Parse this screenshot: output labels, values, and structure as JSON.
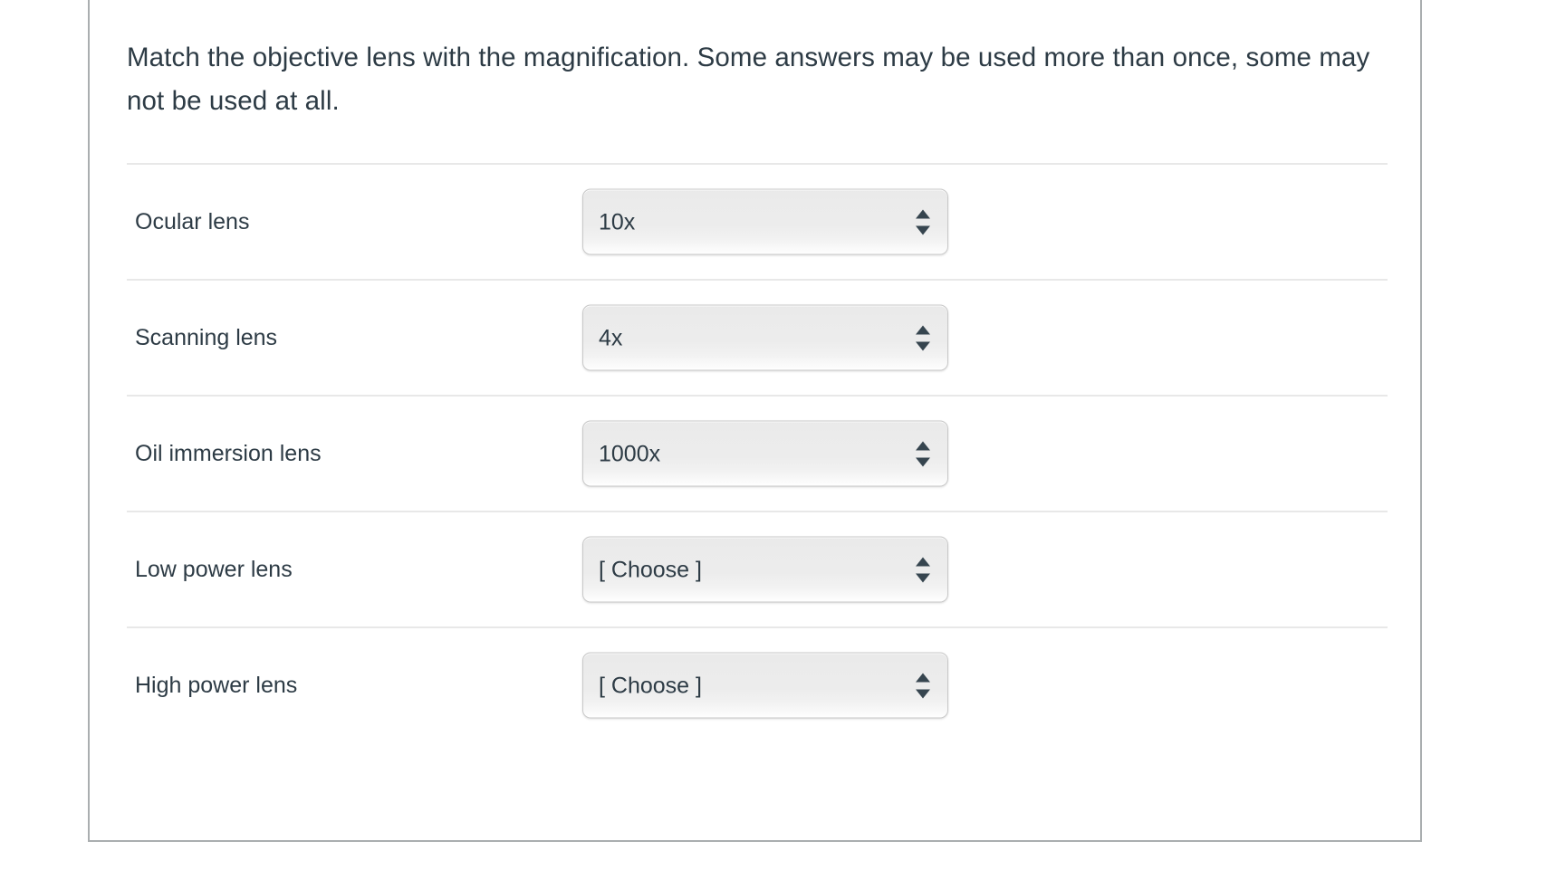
{
  "question": {
    "prompt": "Match the objective lens with the magnification. Some answers may be used more than once, some may not be used at all.",
    "rows": [
      {
        "label": "Ocular lens",
        "value": "10x"
      },
      {
        "label": "Scanning lens",
        "value": "4x"
      },
      {
        "label": "Oil immersion lens",
        "value": "1000x"
      },
      {
        "label": "Low power lens",
        "value": "[ Choose ]"
      },
      {
        "label": "High power lens",
        "value": "[ Choose ]"
      }
    ]
  },
  "icons": {
    "select_arrows": "up-down-arrows-icon"
  },
  "colors": {
    "text": "#2d3b45",
    "card_border": "#aaaeb0",
    "row_divider": "#e8e8e8",
    "select_border": "#c8c8c8",
    "arrow": "#36454f"
  }
}
